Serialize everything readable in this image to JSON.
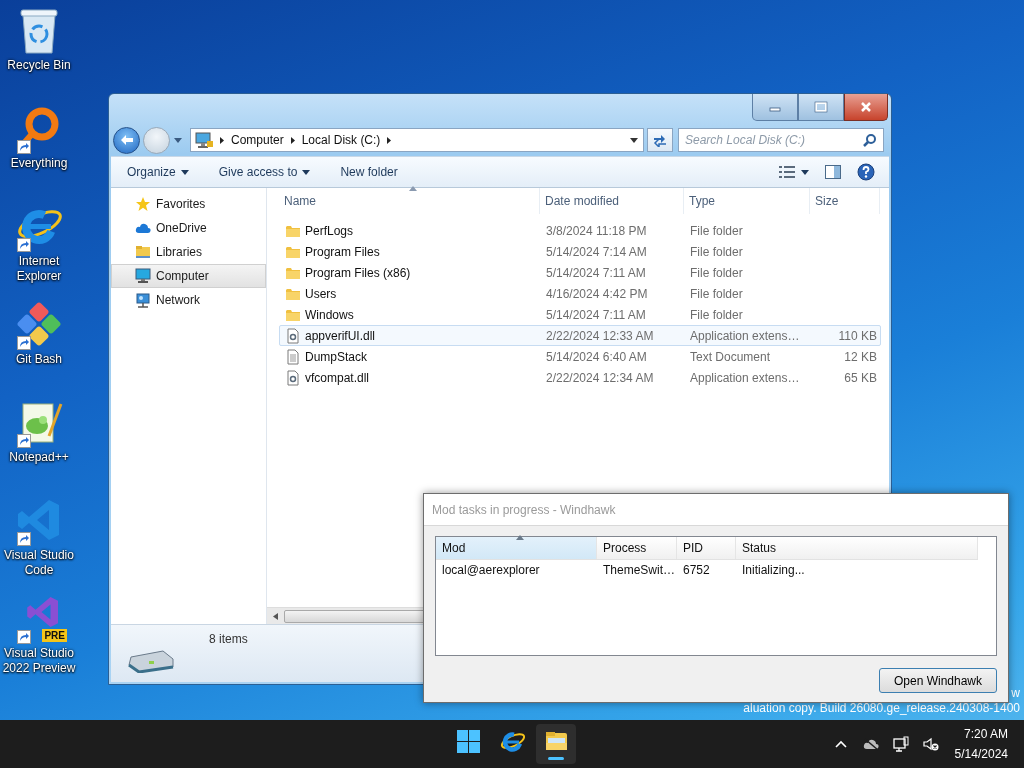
{
  "desktop_icons": [
    {
      "label": "Recycle Bin",
      "kind": "recycle",
      "shortcut": false
    },
    {
      "label": "Everything",
      "kind": "everything",
      "shortcut": true
    },
    {
      "label": "Internet Explorer",
      "kind": "ie",
      "shortcut": true
    },
    {
      "label": "Git Bash",
      "kind": "gitbash",
      "shortcut": true
    },
    {
      "label": "Notepad++",
      "kind": "notepad",
      "shortcut": true
    },
    {
      "label": "Visual Studio Code",
      "kind": "vscode",
      "shortcut": true
    },
    {
      "label": "Visual Studio 2022 Preview",
      "kind": "vs",
      "shortcut": true,
      "badge": "PRE"
    }
  ],
  "explorer": {
    "address": [
      "Computer",
      "Local Disk (C:)"
    ],
    "search": {
      "placeholder": "Search Local Disk (C:)"
    },
    "toolbar": [
      {
        "label": "Organize",
        "dropdown": true
      },
      {
        "label": "Give access to",
        "dropdown": true
      },
      {
        "label": "New folder",
        "dropdown": false
      }
    ],
    "sidebar": [
      {
        "label": "Favorites",
        "kind": "star",
        "selected": false
      },
      {
        "label": "OneDrive",
        "kind": "cloud",
        "selected": false
      },
      {
        "label": "Libraries",
        "kind": "libraries",
        "selected": false
      },
      {
        "label": "Computer",
        "kind": "computer",
        "selected": true
      },
      {
        "label": "Network",
        "kind": "network",
        "selected": false
      }
    ],
    "columns": [
      {
        "label": "Name",
        "sorted": true
      },
      {
        "label": "Date modified",
        "sorted": false
      },
      {
        "label": "Type",
        "sorted": false
      },
      {
        "label": "Size",
        "sorted": false
      }
    ],
    "rows": [
      {
        "name": "PerfLogs",
        "date": "3/8/2024 11:18 PM",
        "type": "File folder",
        "kind": "folder",
        "highlighted": false
      },
      {
        "name": "Program Files",
        "date": "5/14/2024 7:14 AM",
        "type": "File folder",
        "kind": "folder",
        "highlighted": false
      },
      {
        "name": "Program Files (x86)",
        "date": "5/14/2024 7:11 AM",
        "type": "File folder",
        "kind": "folder",
        "highlighted": false
      },
      {
        "name": "Users",
        "date": "4/16/2024 4:42 PM",
        "type": "File folder",
        "kind": "folder",
        "highlighted": false
      },
      {
        "name": "Windows",
        "date": "5/14/2024 7:11 AM",
        "type": "File folder",
        "kind": "folder",
        "highlighted": false
      },
      {
        "name": "appverifUI.dll",
        "date": "2/22/2024 12:33 AM",
        "type": "Application extens…",
        "size": "110 KB",
        "kind": "dll",
        "highlighted": true
      },
      {
        "name": "DumpStack",
        "date": "5/14/2024 6:40 AM",
        "type": "Text Document",
        "size": "12 KB",
        "kind": "text",
        "highlighted": false
      },
      {
        "name": "vfcompat.dll",
        "date": "2/22/2024 12:34 AM",
        "type": "Application extens…",
        "size": "65 KB",
        "kind": "dll",
        "highlighted": false
      }
    ],
    "status": "8 items"
  },
  "dialog": {
    "title": "Mod tasks in progress - Windhawk",
    "active": false,
    "columns": [
      {
        "label": "Mod",
        "sorted": true
      },
      {
        "label": "Process",
        "sorted": false
      },
      {
        "label": "PID",
        "sorted": false
      },
      {
        "label": "Status",
        "sorted": false
      }
    ],
    "rows": [
      {
        "mod": "local@aerexplorer",
        "process": "ThemeSwit…",
        "pid": "6752",
        "status": "Initializing..."
      }
    ],
    "button": "Open Windhawk"
  },
  "desktop_notice": [
    "w",
    "aluation copy. Build 26080.ge_release.240308-1400"
  ],
  "taskbar": {
    "apps": [
      {
        "kind": "start",
        "active": false
      },
      {
        "kind": "ie",
        "active": false
      },
      {
        "kind": "explorer",
        "active": true
      }
    ],
    "time": "7:20 AM",
    "date": "5/14/2024"
  }
}
